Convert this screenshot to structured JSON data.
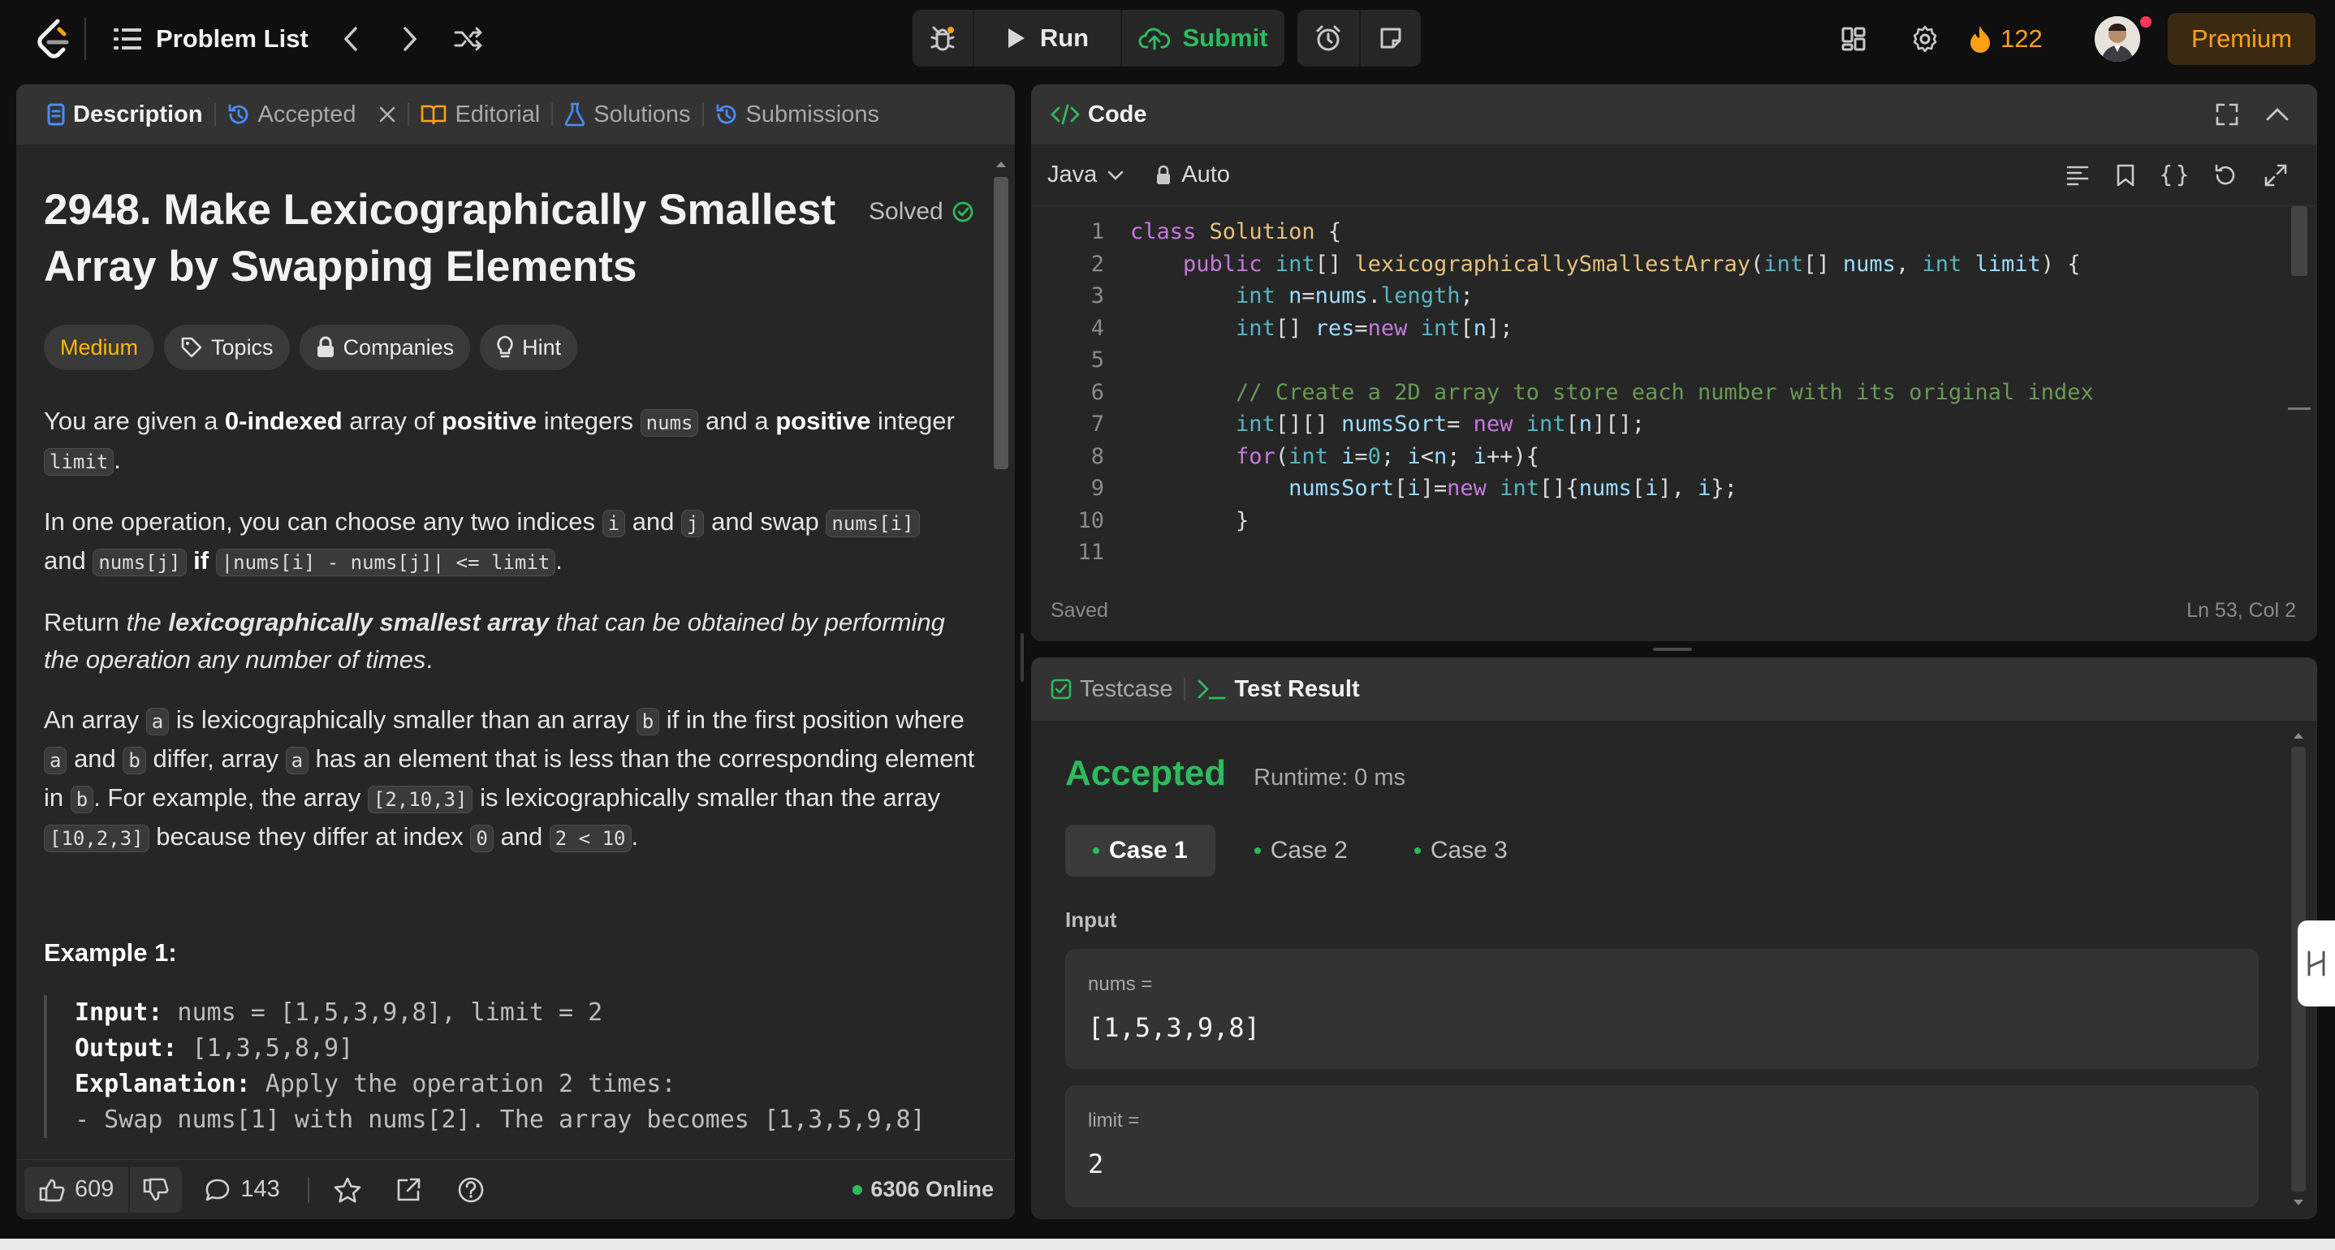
{
  "topbar": {
    "problem_list": "Problem List",
    "run": "Run",
    "submit": "Submit",
    "streak": "122",
    "premium": "Premium"
  },
  "description": {
    "tabs": [
      "Description",
      "Accepted",
      "Editorial",
      "Solutions",
      "Submissions"
    ],
    "title_line1": "2948. Make Lexicographically Smallest",
    "title_line2": "Array by Swapping Elements",
    "solved": "Solved",
    "tags": {
      "difficulty": "Medium",
      "topics": "Topics",
      "companies": "Companies",
      "hint": "Hint"
    },
    "p1": {
      "a": "You are given a ",
      "b": "0-indexed",
      "c": " array of ",
      "d": "positive",
      "e": " integers ",
      "f": "nums",
      "g": " and a ",
      "h": "positive",
      "i": " integer ",
      "j": "limit",
      "k": "."
    },
    "p2": {
      "a": "In one operation, you can choose any two indices ",
      "b": "i",
      "c": " and ",
      "d": "j",
      "e": " and swap ",
      "f": "nums[i]",
      "g": "and ",
      "h": "nums[j]",
      "i": " if ",
      "j": "|nums[i] - nums[j]| <= limit",
      "k": "."
    },
    "p3": {
      "a": "Return ",
      "b": "the ",
      "c": "lexicographically smallest array",
      "d": " that can be obtained by performing the operation any number of times",
      "e": "."
    },
    "p4": {
      "a": "An array ",
      "b": "a",
      "c": " is lexicographically smaller than an array ",
      "d": "b",
      "e": " if in the first position where ",
      "f": "a",
      "g": " and ",
      "h": "b",
      "i": " differ, array ",
      "j": "a",
      "k": " has an element that is less than the corresponding element in ",
      "l": "b",
      "m": ". For example, the array ",
      "n": "[2,10,3]",
      "o": " is lexicographically smaller than the array ",
      "p": "[10,2,3]",
      "q": " because they differ at index ",
      "r": "0",
      "s": " and ",
      "t": "2 < 10",
      "u": "."
    },
    "example_title": "Example 1:",
    "example": {
      "input_label": "Input:",
      "input_value": " nums = [1,5,3,9,8], limit = 2",
      "output_label": "Output:",
      "output_value": " [1,3,5,8,9]",
      "explanation_label": "Explanation:",
      "explanation_value": " Apply the operation 2 times:",
      "line4": "- Swap nums[1] with nums[2]. The array becomes [1,3,5,9,8]"
    },
    "footer": {
      "likes": "609",
      "comments": "143",
      "online": "6306 Online"
    }
  },
  "code": {
    "title": "Code",
    "language": "Java",
    "mode": "Auto",
    "status": "Saved",
    "cursor": "Ln 53, Col 2",
    "line_numbers": [
      "1",
      "2",
      "3",
      "4",
      "5",
      "6",
      "7",
      "8",
      "9",
      "10",
      "11"
    ],
    "lines": [
      "class Solution {",
      "    public int[] lexicographicallySmallestArray(int[] nums, int limit) {",
      "        int n=nums.length;",
      "        int[] res=new int[n];",
      "",
      "        // Create a 2D array to store each number with its original index",
      "        int[][] numsSort= new int[n][];",
      "        for(int i=0; i<n; i++){",
      "            numsSort[i]=new int[]{nums[i], i};",
      "        }",
      ""
    ]
  },
  "result": {
    "tabs": [
      "Testcase",
      "Test Result"
    ],
    "verdict": "Accepted",
    "runtime": "Runtime: 0 ms",
    "cases": [
      "Case 1",
      "Case 2",
      "Case 3"
    ],
    "input_label": "Input",
    "params": [
      {
        "name": "nums =",
        "value": "[1,5,3,9,8]"
      },
      {
        "name": "limit =",
        "value": "2"
      }
    ]
  },
  "colors": {
    "accent": "#ffa116",
    "green": "#2cbb5d",
    "medium": "#ffb800",
    "blue": "#4a8cff"
  }
}
